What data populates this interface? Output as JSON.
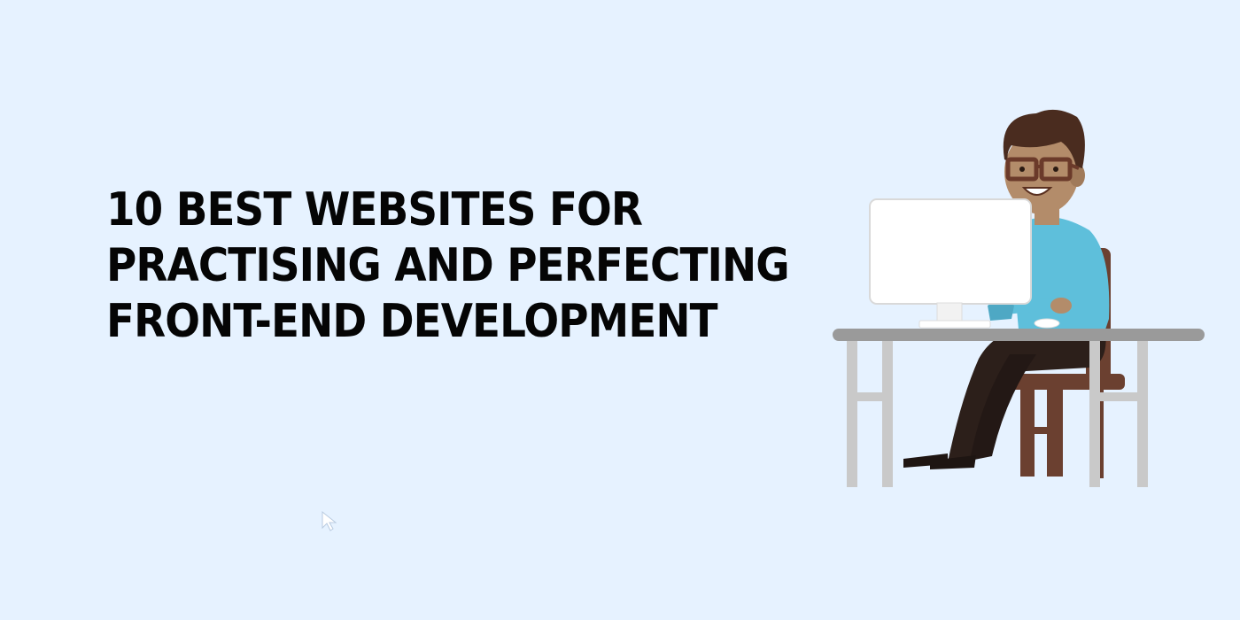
{
  "banner": {
    "title_lines": [
      "10 BEST WEBSITES FOR",
      "PRACTISING AND PERFECTING",
      "FRONT-END DEVELOPMENT"
    ]
  },
  "illustration": {
    "subject": "developer-at-desk-illustration",
    "colors": {
      "background": "#e6f2ff",
      "shirt": "#5ebfdb",
      "hair": "#4a2c1f",
      "skin": "#b38c6a",
      "glasses": "#6b3a2a",
      "desk": "#9a9a9a",
      "desk_legs": "#c9c9c9",
      "chair": "#6b4030",
      "trousers": "#2c1f1a",
      "monitor": "#ffffff",
      "title_text": "#050505"
    }
  }
}
